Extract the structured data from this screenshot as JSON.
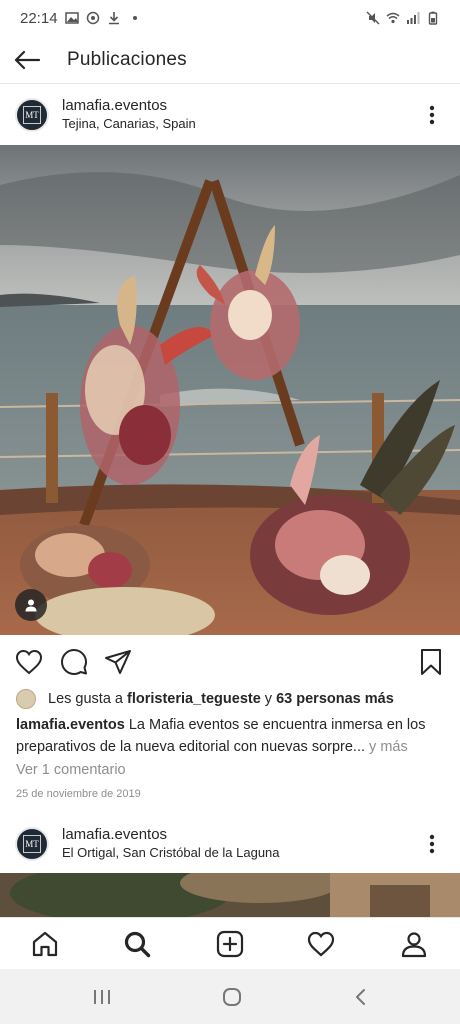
{
  "status_bar": {
    "time": "22:14"
  },
  "header": {
    "title": "Publicaciones"
  },
  "posts": [
    {
      "username": "lamafia.eventos",
      "location": "Tejina, Canarias, Spain",
      "avatar_letters": "MT",
      "likes_prefix": "Les gusta a ",
      "likes_user": "floristeria_tegueste",
      "likes_connector": " y ",
      "likes_count": "63 personas más",
      "caption_user": "lamafia.eventos",
      "caption_text": "La Mafia eventos se encuentra inmersa en los preparativos de la nueva editorial con nuevas sorpre...",
      "caption_more": "y más",
      "comments_link": "Ver 1 comentario",
      "date": "25 de noviembre de 2019"
    },
    {
      "username": "lamafia.eventos",
      "location": "El Ortigal, San Cristóbal de la Laguna",
      "avatar_letters": "MT"
    }
  ],
  "icons": {
    "back": "arrow-left-icon",
    "more": "more-vertical-icon",
    "like": "heart-icon",
    "comment": "comment-icon",
    "share": "send-icon",
    "save": "bookmark-icon",
    "user_tag": "user-tag-icon"
  },
  "bottom_nav": [
    "home-icon",
    "search-icon",
    "add-post-icon",
    "activity-heart-icon",
    "profile-icon"
  ],
  "colors": {
    "text": "#262626",
    "muted": "#8e8e8e",
    "divider": "#e6e6e6"
  }
}
